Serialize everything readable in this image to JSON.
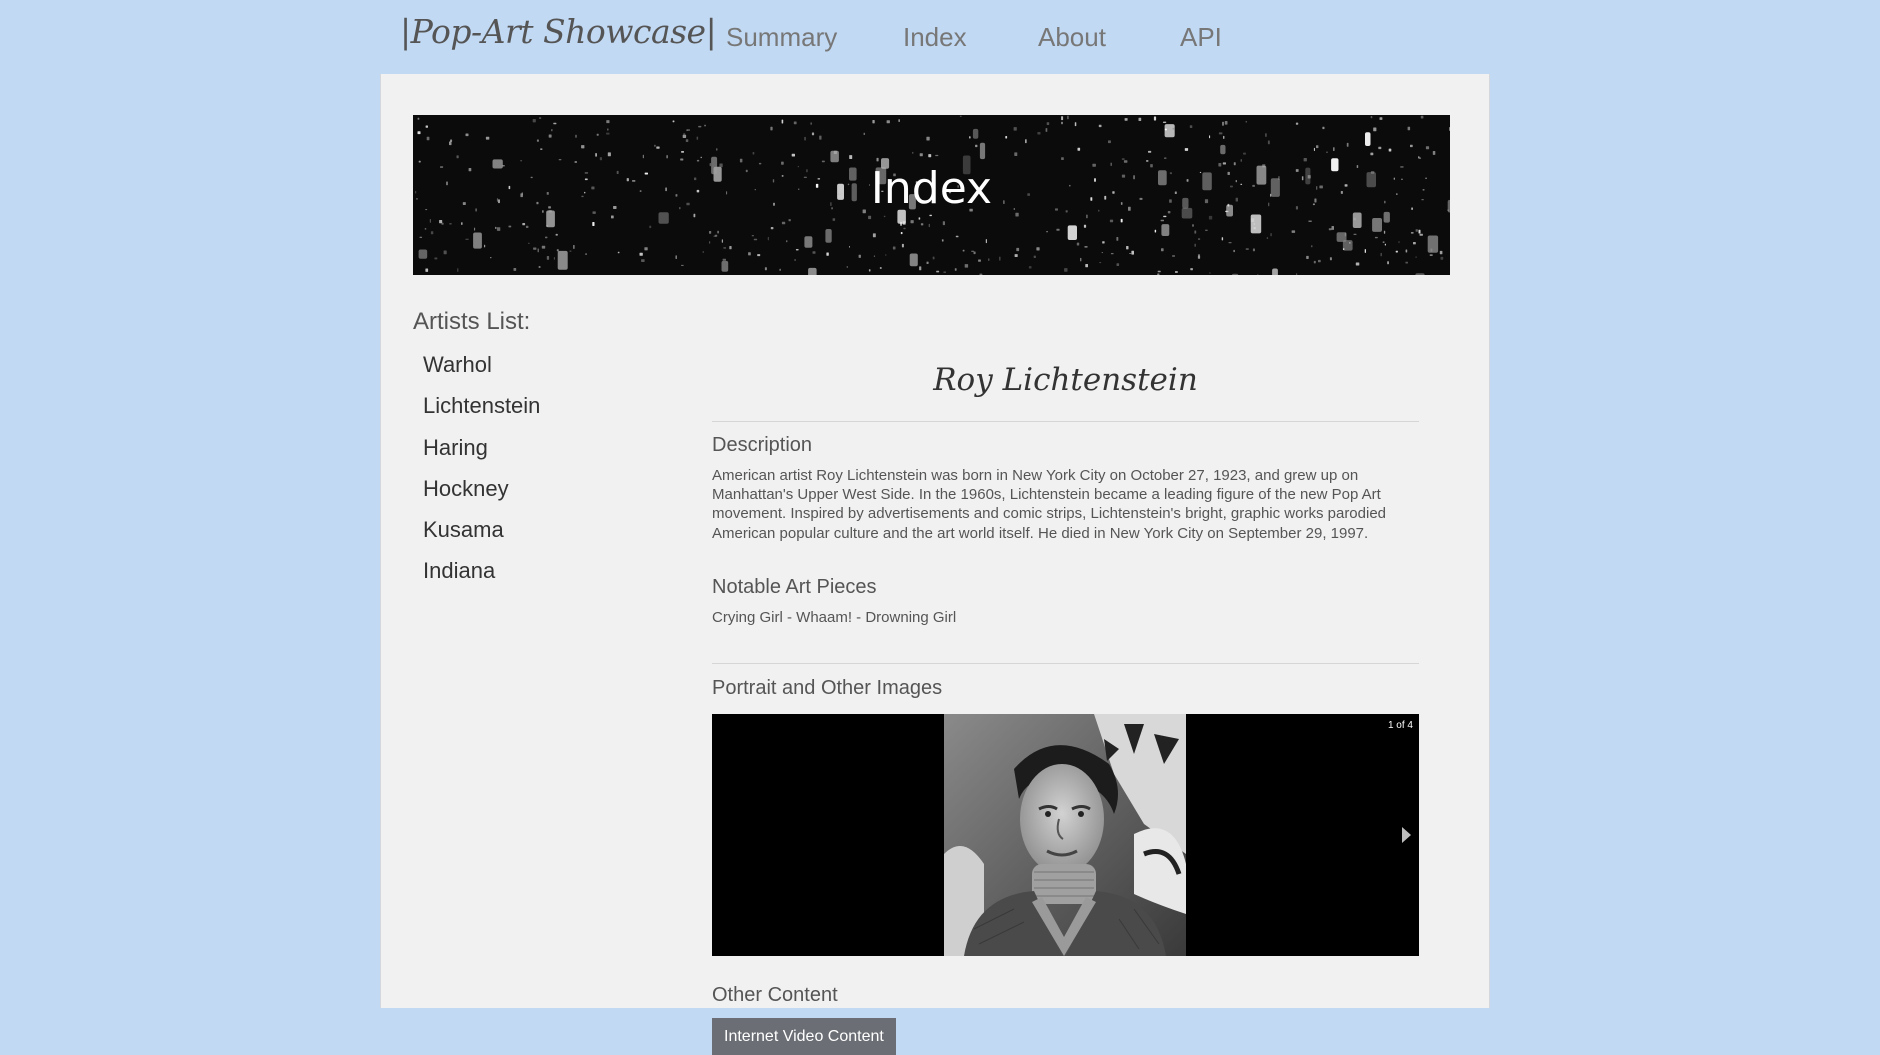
{
  "brand": {
    "title": "|Pop-Art Showcase|"
  },
  "nav": [
    {
      "label": "Summary"
    },
    {
      "label": "Index"
    },
    {
      "label": "About"
    },
    {
      "label": "API"
    }
  ],
  "hero": {
    "title": "Index"
  },
  "sidebar": {
    "title": "Artists List:",
    "items": [
      {
        "label": "Warhol"
      },
      {
        "label": "Lichtenstein"
      },
      {
        "label": "Haring"
      },
      {
        "label": "Hockney"
      },
      {
        "label": "Kusama"
      },
      {
        "label": "Indiana"
      }
    ]
  },
  "artist": {
    "name": "Roy Lichtenstein",
    "description_heading": "Description",
    "description": "American artist Roy Lichtenstein was born in New York City on October 27, 1923, and grew up on Manhattan's Upper West Side. In the 1960s, Lichtenstein became a leading figure of the new Pop Art movement. Inspired by advertisements and comic strips, Lichtenstein's bright, graphic works parodied American popular culture and the art world itself. He died in New York City on September 29, 1997.",
    "notable_heading": "Notable Art Pieces",
    "notable_pieces": "Crying Girl - Whaam! - Drowning Girl",
    "images_heading": "Portrait and Other Images",
    "carousel_counter": "1 of 4",
    "other_heading": "Other Content",
    "video_button": "Internet Video Content"
  },
  "colors": {
    "page_background": "#c2d9f3",
    "panel_background": "#f0f1f0",
    "button_background": "#6b6e75"
  }
}
